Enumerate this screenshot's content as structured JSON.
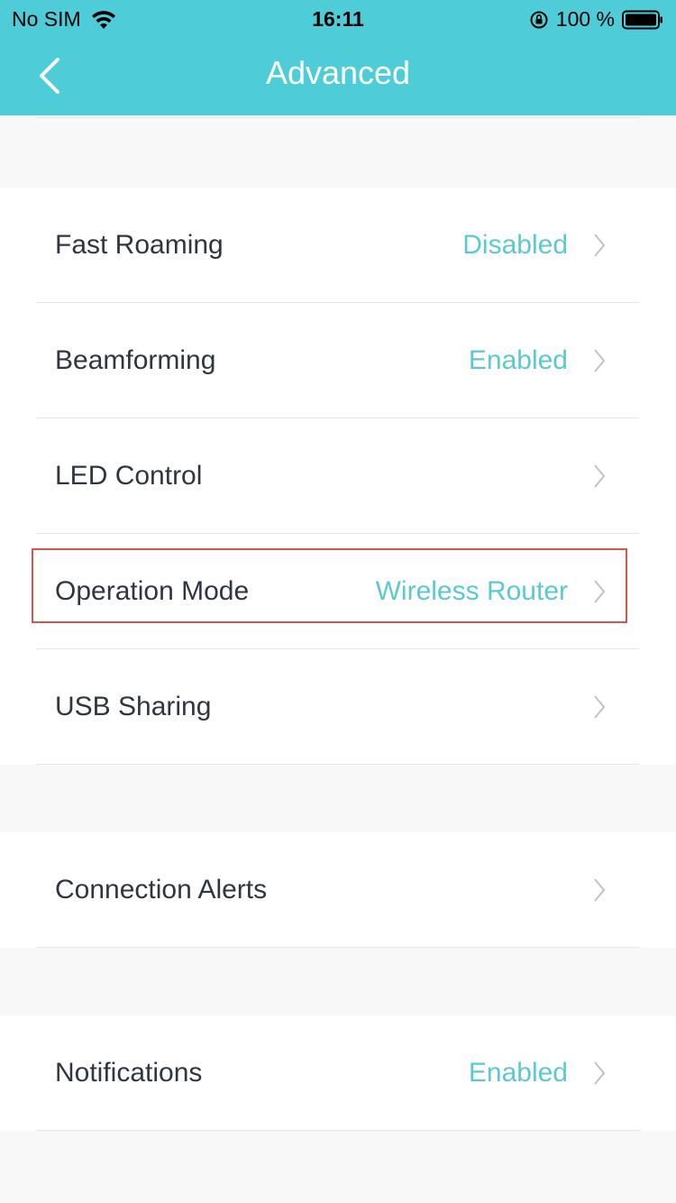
{
  "status_bar": {
    "carrier": "No SIM",
    "time": "16:11",
    "battery": "100 %"
  },
  "header": {
    "title": "Advanced",
    "back_icon": "chevron-left-icon"
  },
  "colors": {
    "header_bg": "#4ecdd8",
    "value_text": "#5bc9d2",
    "label_text": "#2f3640",
    "highlight": "#d9534f"
  },
  "settings": {
    "fast_roaming": {
      "label": "Fast Roaming",
      "value": "Disabled"
    },
    "beamforming": {
      "label": "Beamforming",
      "value": "Enabled"
    },
    "led_control": {
      "label": "LED Control",
      "value": ""
    },
    "operation_mode": {
      "label": "Operation Mode",
      "value": "Wireless Router"
    },
    "usb_sharing": {
      "label": "USB Sharing",
      "value": ""
    },
    "connection_alerts": {
      "label": "Connection Alerts",
      "value": ""
    },
    "notifications": {
      "label": "Notifications",
      "value": "Enabled"
    }
  }
}
